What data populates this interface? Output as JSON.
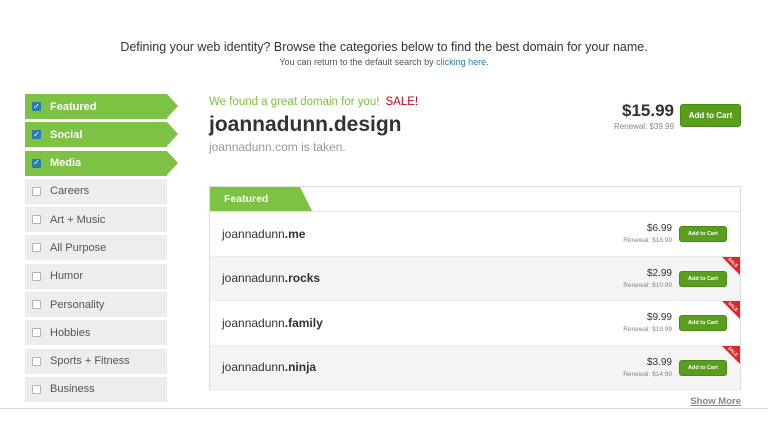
{
  "header": {
    "intro": "Defining your web identity? Browse the categories below to find the best domain for your name.",
    "sub_prefix": "You can return to the default search by",
    "sub_link": "clicking here",
    "sub_suffix": "."
  },
  "sidebar": {
    "items": [
      {
        "label": "Featured",
        "checked": true
      },
      {
        "label": "Social",
        "checked": true
      },
      {
        "label": "Media",
        "checked": true
      },
      {
        "label": "Careers",
        "checked": false
      },
      {
        "label": "Art + Music",
        "checked": false
      },
      {
        "label": "All Purpose",
        "checked": false
      },
      {
        "label": "Humor",
        "checked": false
      },
      {
        "label": "Personality",
        "checked": false
      },
      {
        "label": "Hobbies",
        "checked": false
      },
      {
        "label": "Sports + Fitness",
        "checked": false
      },
      {
        "label": "Business",
        "checked": false
      }
    ],
    "check_mark": "✓"
  },
  "hero": {
    "found_text": "We found a great domain for you!",
    "sale_text": "SALE!",
    "domain": "joannadunn.design",
    "taken_text": "joannadunn.com is taken.",
    "price": "$15.99",
    "renewal": "Renewal: $39.99",
    "button": "Add to Cart"
  },
  "results": {
    "tab_label": "Featured",
    "rows": [
      {
        "name": "joannadunn",
        "tld": ".me",
        "price": "$6.99",
        "renewal": "Renewal: $18.99",
        "button": "Add to Cart",
        "sale": false
      },
      {
        "name": "joannadunn",
        "tld": ".rocks",
        "price": "$2.99",
        "renewal": "Renewal: $10.99",
        "button": "Add to Cart",
        "sale": true
      },
      {
        "name": "joannadunn",
        "tld": ".family",
        "price": "$9.99",
        "renewal": "Renewal: $19.99",
        "button": "Add to Cart",
        "sale": true
      },
      {
        "name": "joannadunn",
        "tld": ".ninja",
        "price": "$3.99",
        "renewal": "Renewal: $14.99",
        "button": "Add to Cart",
        "sale": true
      }
    ],
    "sale_ribbon": "SALE",
    "show_more": "Show More"
  },
  "colors": {
    "accent_green": "#7dc242",
    "button_green": "#5a9e1e",
    "link_blue": "#2a7ab8",
    "sale_red": "#d0021b"
  }
}
